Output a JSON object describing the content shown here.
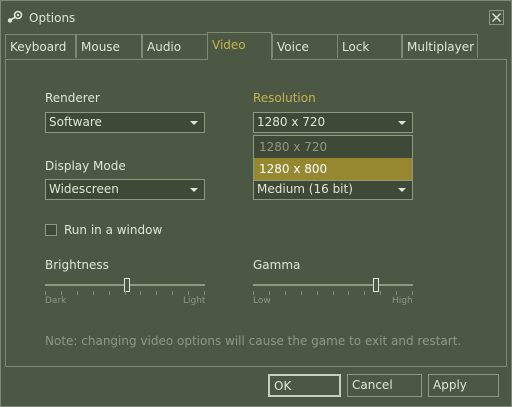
{
  "window": {
    "title": "Options",
    "close_icon": "close-icon",
    "app_icon": "steam-icon"
  },
  "tabs": [
    {
      "label": "Keyboard"
    },
    {
      "label": "Mouse"
    },
    {
      "label": "Audio"
    },
    {
      "label": "Video",
      "active": true
    },
    {
      "label": "Voice"
    },
    {
      "label": "Lock"
    },
    {
      "label": "Multiplayer"
    }
  ],
  "video": {
    "renderer": {
      "label": "Renderer",
      "value": "Software"
    },
    "resolution": {
      "label": "Resolution",
      "value": "1280 x 720",
      "options": [
        "1280 x 720",
        "1280 x 800"
      ],
      "highlighted": "1280 x 800"
    },
    "display_mode": {
      "label": "Display Mode",
      "value": "Widescreen"
    },
    "color_quality": {
      "value": "Medium (16 bit)"
    },
    "run_in_window": {
      "label": "Run in a window",
      "checked": false
    },
    "brightness": {
      "label": "Brightness",
      "min_label": "Dark",
      "max_label": "Light",
      "level": 0.51
    },
    "gamma": {
      "label": "Gamma",
      "min_label": "Low",
      "max_label": "High",
      "level": 0.77
    },
    "note": "Note: changing video options will cause the game to exit and restart."
  },
  "buttons": {
    "ok": "OK",
    "cancel": "Cancel",
    "apply": "Apply"
  },
  "colors": {
    "background": "#4c5844",
    "accent": "#c4b550",
    "selection": "#958830",
    "text": "#dfe6d6"
  }
}
